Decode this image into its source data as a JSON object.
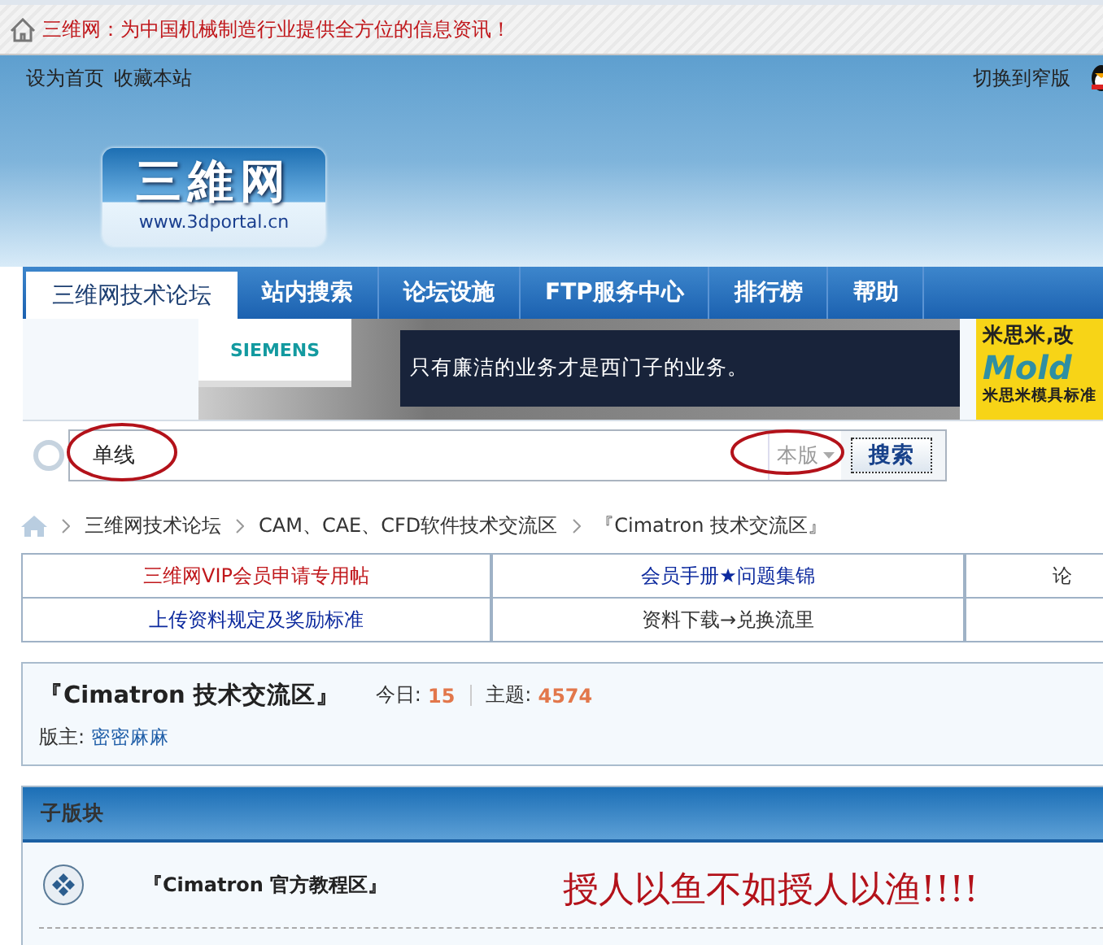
{
  "top_notice": "三维网：为中国机械制造行业提供全方位的信息资讯！",
  "header": {
    "links": [
      "设为首页",
      "收藏本站"
    ],
    "switch_link": "切换到窄版",
    "logo": {
      "title": "三維网",
      "url": "www.3dportal.cn"
    }
  },
  "nav": [
    {
      "label": "三维网技术论坛",
      "selected": true
    },
    {
      "label": "站内搜索",
      "selected": false
    },
    {
      "label": "论坛设施",
      "selected": false
    },
    {
      "label": "FTP服务中心",
      "selected": false
    },
    {
      "label": "排行榜",
      "selected": false
    },
    {
      "label": "帮助",
      "selected": false
    }
  ],
  "ads": [
    {
      "kind": "siemens",
      "brand": "SIEMENS",
      "text": "只有廉洁的业务才是西门子的业务。"
    },
    {
      "kind": "misumi",
      "headline": "米思米,改",
      "brand": "Mold",
      "text": "米思米模具标准"
    }
  ],
  "search": {
    "value": "单线",
    "scope": "本版",
    "button": "搜索"
  },
  "breadcrumb": [
    "三维网技术论坛",
    "CAM、CAE、CFD软件技术交流区",
    "『Cimatron 技术交流区』"
  ],
  "quick_links": [
    [
      {
        "text": "三维网VIP会员申请专用帖",
        "color": "#c0171b"
      },
      {
        "text": "会员手册★问题集锦",
        "color": "#0d2a9e"
      },
      {
        "text": "论",
        "color": "#333333"
      }
    ],
    [
      {
        "text": "上传资料规定及奖励标准",
        "color": "#0d2a9e"
      },
      {
        "text": "资料下载→兑换流里",
        "color": "#333333"
      }
    ]
  ],
  "forum": {
    "title": "『Cimatron 技术交流区』",
    "today_label": "今日:",
    "today": "15",
    "topics_label": "主题:",
    "topics": "4574",
    "moderator_label": "版主:",
    "moderator": "密密麻麻"
  },
  "subforums": {
    "title": "子版块",
    "items": [
      {
        "name": "『Cimatron 官方教程区』"
      }
    ]
  },
  "annotation": "授人以鱼不如授人以渔!!!!"
}
